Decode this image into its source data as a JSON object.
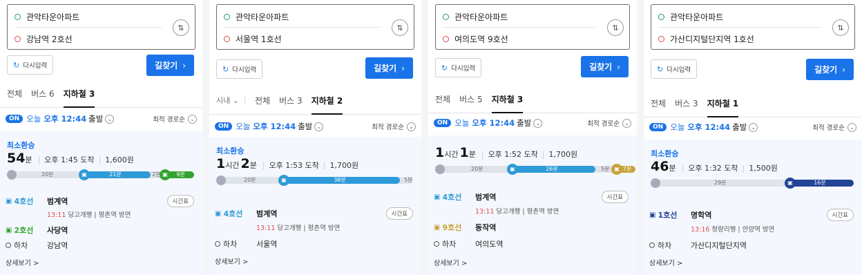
{
  "colors": {
    "line4": "#2e9ad8",
    "line2": "#35a32f",
    "line1": "#234397",
    "line9": "#c8a13a",
    "accent": "#1a73e8",
    "red": "#e24b4b"
  },
  "common": {
    "start_name": "관악타운아파트",
    "swap_icon": "⇅",
    "reset_label": "다시입력",
    "search_label": "길찾기",
    "on_label": "ON",
    "today": "오늘",
    "time": "오후 12:44",
    "dep_label": "출발",
    "sort_label": "최적 경로순",
    "best_label": "최소환승",
    "detail_label": "상세보기 >",
    "timetable_label": "시간표",
    "alight_label": "하차"
  },
  "panels": [
    {
      "destination": "강남역 2호선",
      "tabs": [
        "전체",
        "버스 6",
        "지하철 3"
      ],
      "duration": {
        "h": "",
        "h_unit": "",
        "m": "54",
        "m_unit": "분"
      },
      "arrival": "오후 1:45 도착",
      "fare": "1,600원",
      "bar": {
        "walk1": "20분",
        "seg1": "21분",
        "walk2": "2분",
        "seg2": "9분"
      },
      "board": {
        "line": "4호선",
        "station": "범계역",
        "time": "13:11",
        "dir": "당고개행 | 평촌역 방면"
      },
      "transfer": {
        "line": "2호선",
        "station": "사당역"
      },
      "alight": "강남역"
    },
    {
      "destination": "서울역 1호선",
      "region": "시내",
      "tabs": [
        "전체",
        "버스 3",
        "지하철 2"
      ],
      "duration": {
        "h": "1",
        "h_unit": "시간",
        "m": "2",
        "m_unit": "분"
      },
      "arrival": "오후 1:53 도착",
      "fare": "1,700원",
      "bar": {
        "walk1": "20분",
        "seg1": "38분",
        "walk2": "5분"
      },
      "board": {
        "line": "4호선",
        "station": "범계역",
        "time": "13:11",
        "dir": "당고개행 | 평촌역 방면"
      },
      "alight": "서울역"
    },
    {
      "destination": "여의도역 9호선",
      "tabs": [
        "전체",
        "버스 5",
        "지하철 3"
      ],
      "duration": {
        "h": "1",
        "h_unit": "시간",
        "m": "1",
        "m_unit": "분"
      },
      "arrival": "오후 1:52 도착",
      "fare": "1,700원",
      "bar": {
        "walk1": "20분",
        "seg1": "26분",
        "walk2": "5분",
        "seg2": "7분"
      },
      "board": {
        "line": "4호선",
        "station": "범계역",
        "time": "13:11",
        "dir": "당고개행 | 평촌역 방면"
      },
      "transfer": {
        "line": "9호선",
        "station": "동작역"
      },
      "alight": "여의도역"
    },
    {
      "destination": "가산디지털단지역 1호선",
      "tabs": [
        "전체",
        "버스 3",
        "지하철 1"
      ],
      "duration": {
        "h": "",
        "h_unit": "",
        "m": "46",
        "m_unit": "분"
      },
      "arrival": "오후 1:32 도착",
      "fare": "1,500원",
      "bar": {
        "walk1": "29분",
        "seg1": "16분"
      },
      "board": {
        "line": "1호선",
        "station": "명학역",
        "time": "13:16",
        "dir": "청량리행 | 안양역 방면"
      },
      "alight": "가산디지털단지역"
    }
  ]
}
